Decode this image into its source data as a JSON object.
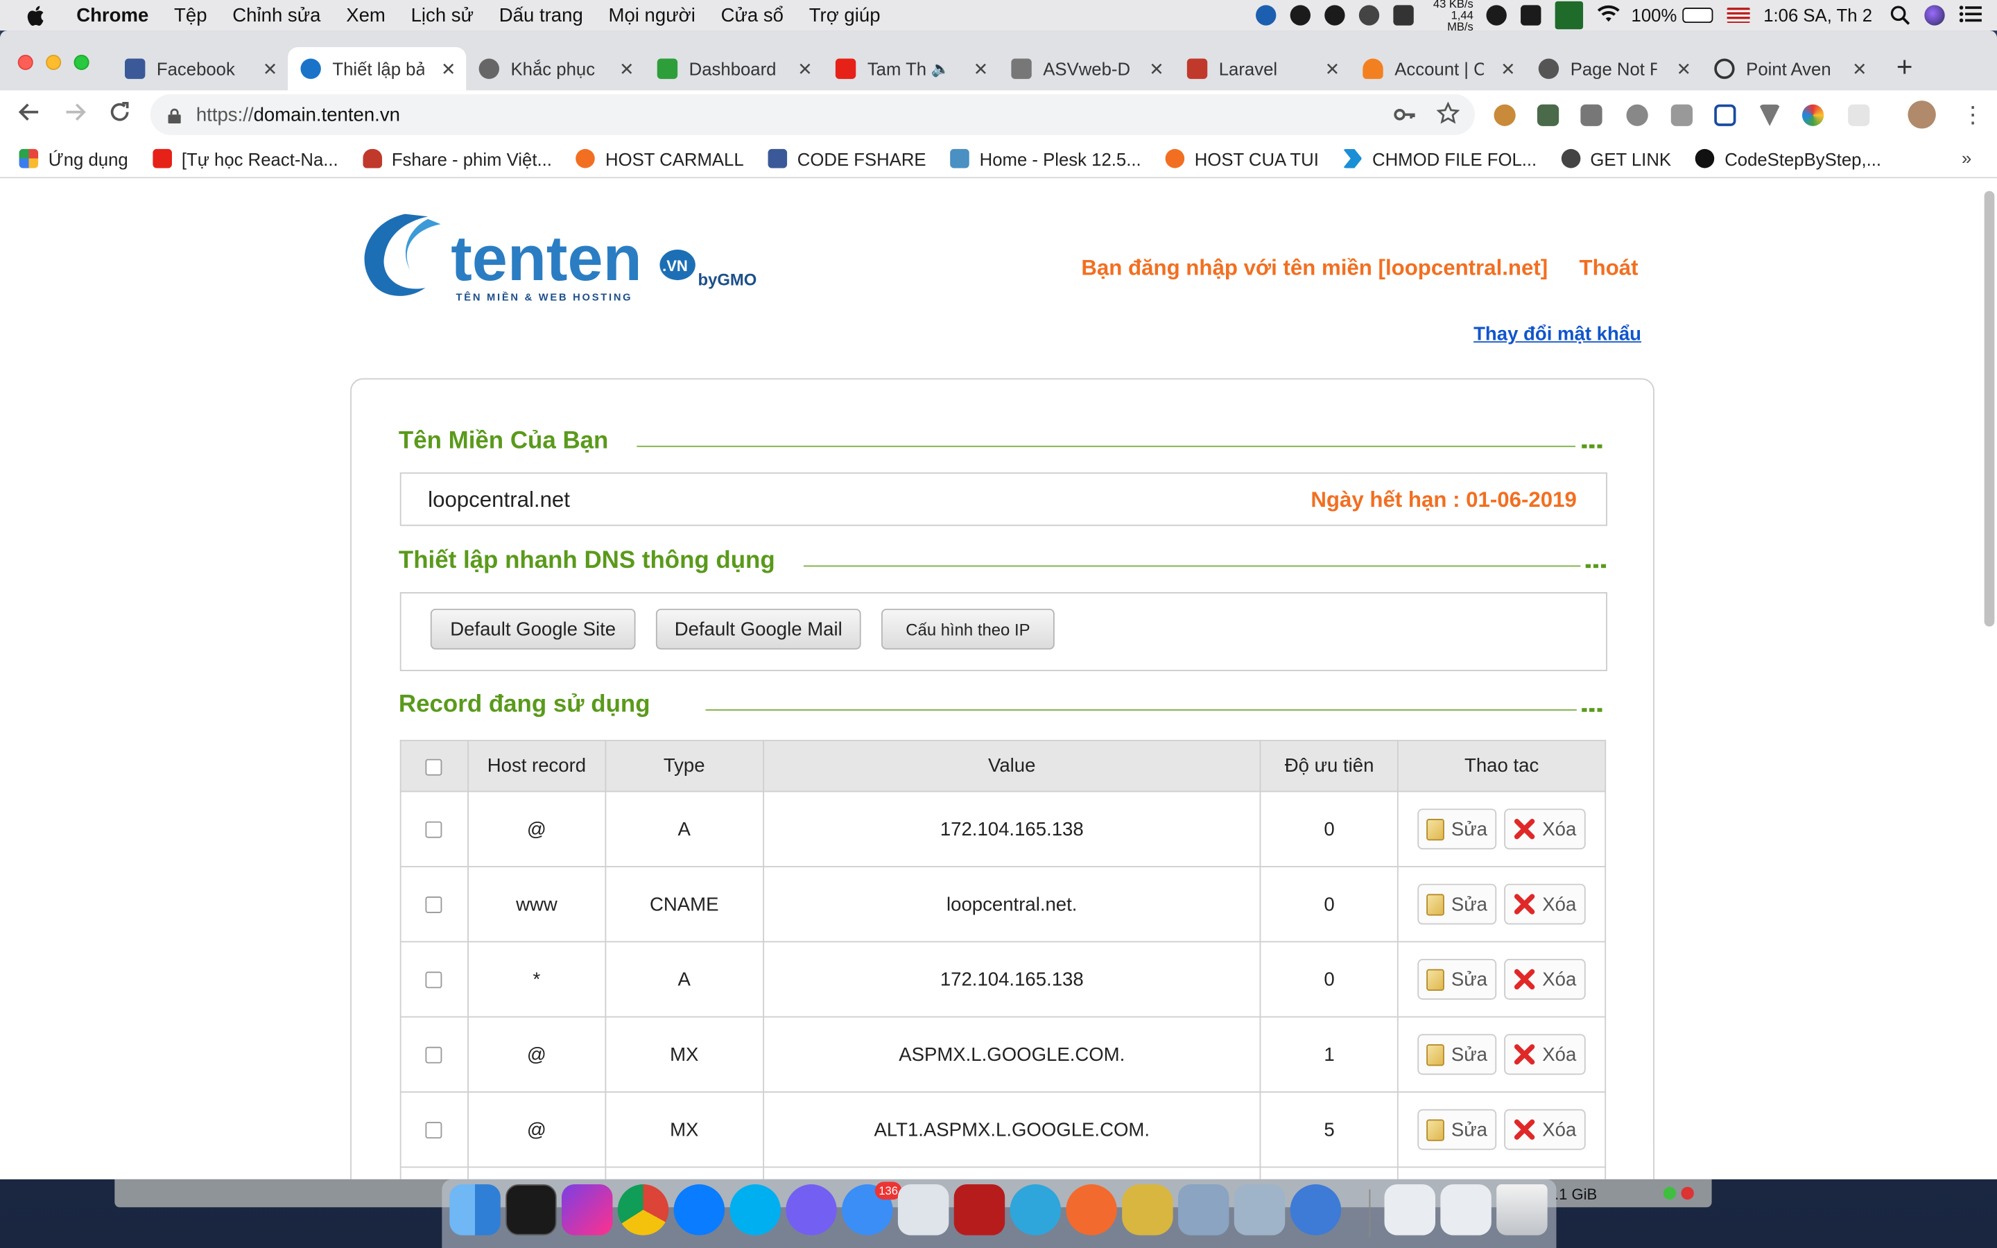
{
  "menubar": {
    "app": "Chrome",
    "items": [
      "Tệp",
      "Chỉnh sửa",
      "Xem",
      "Lịch sử",
      "Dấu trang",
      "Mọi người",
      "Cửa sổ",
      "Trợ giúp"
    ],
    "speed_up": "43 KB/s",
    "speed_down": "1,44 MB/s",
    "battery": "100%",
    "clock": "1:06 SA, Th 2"
  },
  "tabs": [
    {
      "label": "Facebook",
      "color": "#3b5998"
    },
    {
      "label": "Thiết lập bả",
      "color": "#1a73c8"
    },
    {
      "label": "Khắc phục",
      "color": "#555555"
    },
    {
      "label": "Dashboard",
      "color": "#2e9e3a"
    },
    {
      "label": "Tam Th",
      "color": "#e62117"
    },
    {
      "label": "ASVweb-D",
      "color": "#666666"
    },
    {
      "label": "Laravel",
      "color": "#c0392b"
    },
    {
      "label": "Account | C",
      "color": "#f38020"
    },
    {
      "label": "Page Not F",
      "color": "#444444"
    },
    {
      "label": "Point Aven",
      "color": "#333333"
    }
  ],
  "address": {
    "scheme": "https://",
    "host": "domain.tenten.vn"
  },
  "bookmarks": [
    {
      "label": "Ứng dụng",
      "color": "#e8453c"
    },
    {
      "label": "[Tự học React-Na...",
      "color": "#e62117"
    },
    {
      "label": "Fshare - phim Việt...",
      "color": "#c0392b"
    },
    {
      "label": "HOST CARMALL",
      "color": "#f26f21"
    },
    {
      "label": "CODE FSHARE",
      "color": "#3b5998"
    },
    {
      "label": "Home - Plesk 12.5...",
      "color": "#4a90c2"
    },
    {
      "label": "HOST CUA TUI",
      "color": "#f26f21"
    },
    {
      "label": "CHMOD FILE FOL...",
      "color": "#1a8fd6"
    },
    {
      "label": "GET LINK",
      "color": "#444444"
    },
    {
      "label": "CodeStepByStep,...",
      "color": "#111111"
    }
  ],
  "page": {
    "logo_text": "tenten",
    "logo_vn": ".VN",
    "logo_by": "byGMO",
    "logo_tag": "TÊN MIỀN & WEB HOSTING",
    "login_text": "Bạn đăng nhập với tên miền [loopcentral.net]",
    "logout": "Thoát",
    "change_password": "Thay đổi mật khẩu",
    "section_domain": "Tên Miền Của Bạn",
    "domain_name": "loopcentral.net",
    "expiry": "Ngày hết hạn : 01-06-2019",
    "section_dns": "Thiết lập nhanh DNS thông dụng",
    "btn_google_site": "Default Google Site",
    "btn_google_mail": "Default Google Mail",
    "btn_config_ip": "Cấu hình theo IP",
    "section_records": "Record đang sử dụng",
    "table_headers": [
      "Host record",
      "Type",
      "Value",
      "Độ ưu tiên",
      "Thao tac"
    ],
    "edit_label": "Sửa",
    "delete_label": "Xóa",
    "records": [
      {
        "host": "@",
        "type": "A",
        "value": "172.104.165.138",
        "priority": "0"
      },
      {
        "host": "www",
        "type": "CNAME",
        "value": "loopcentral.net.",
        "priority": "0"
      },
      {
        "host": "*",
        "type": "A",
        "value": "172.104.165.138",
        "priority": "0"
      },
      {
        "host": "@",
        "type": "MX",
        "value": "ASPMX.L.GOOGLE.COM.",
        "priority": "1"
      },
      {
        "host": "@",
        "type": "MX",
        "value": "ALT1.ASPMX.L.GOOGLE.COM.",
        "priority": "5"
      }
    ]
  },
  "dock": {
    "memory": ".1 GiB",
    "badge": "136"
  },
  "colors": {
    "accent_orange": "#f26f21",
    "section_green": "#5a9a1b",
    "link_blue": "#1155cc"
  }
}
